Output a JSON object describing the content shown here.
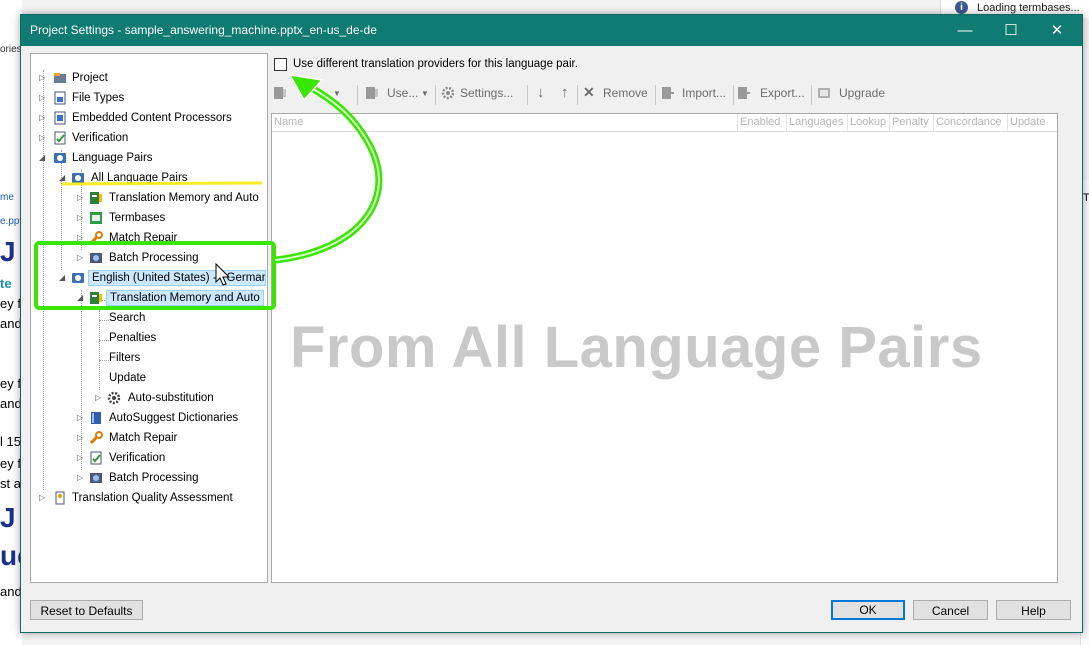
{
  "background": {
    "info_text": "Loading termbases...",
    "fragments": [
      "ories",
      "me",
      "e.ppt",
      "J U",
      "te",
      "ey f",
      "and",
      "ey f",
      "and",
      "l 15",
      "ey f",
      "st a",
      "J U",
      "uc",
      "and",
      "T"
    ]
  },
  "dialog": {
    "title": "Project Settings - sample_answering_machine.pptx_en-us_de-de",
    "window_buttons": {
      "minimize": "—",
      "maximize": "☐",
      "close": "✕"
    }
  },
  "tree": {
    "project": "Project",
    "file_types": "File Types",
    "embedded": "Embedded Content Processors",
    "verification": "Verification",
    "language_pairs": "Language Pairs",
    "all_language_pairs": "All Language Pairs",
    "tm_auto_1": "Translation Memory and Auto",
    "termbases": "Termbases",
    "match_repair_1": "Match Repair",
    "batch_processing_1": "Batch Processing",
    "en_de": "English (United States) -> German (",
    "tm_auto_2": "Translation Memory and Auto",
    "search": "Search",
    "penalties": "Penalties",
    "filters": "Filters",
    "update": "Update",
    "auto_substitution": "Auto-substitution",
    "autosuggest": "AutoSuggest Dictionaries",
    "match_repair_2": "Match Repair",
    "verification_2": "Verification",
    "batch_processing_2": "Batch Processing",
    "tqa": "Translation Quality Assessment"
  },
  "right": {
    "checkbox_label": "Use different translation providers for this language pair.",
    "toolbar": {
      "use_label": "Use...",
      "settings": "Settings...",
      "remove": "Remove",
      "import": "Import...",
      "export": "Export...",
      "upgrade": "Upgrade"
    },
    "columns": [
      "Name",
      "Enabled",
      "Languages",
      "Lookup",
      "Penalty",
      "Concordance",
      "Update"
    ],
    "watermark": "From All Language Pairs"
  },
  "footer": {
    "reset": "Reset to Defaults",
    "ok": "OK",
    "cancel": "Cancel",
    "help": "Help"
  },
  "colors": {
    "titlebar": "#0f7b72",
    "highlight_green": "#39e600",
    "highlight_yellow": "#f5ea00",
    "selection": "#cce8ff"
  }
}
